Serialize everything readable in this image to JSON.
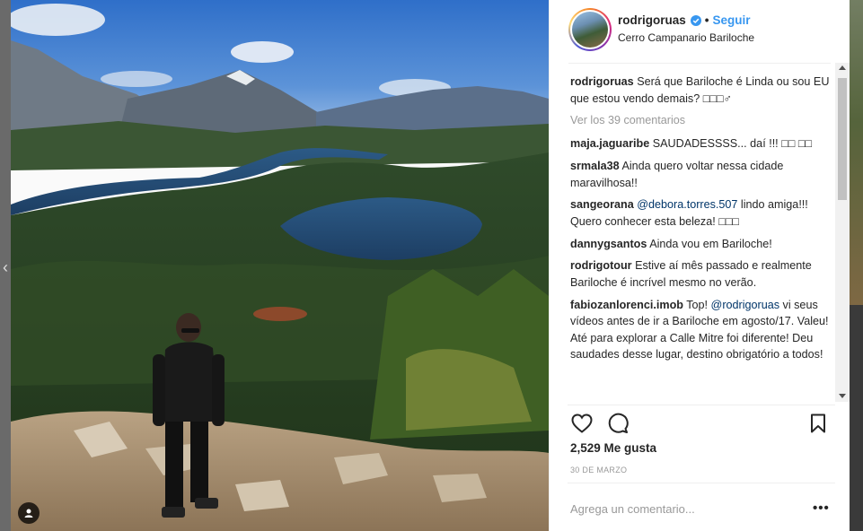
{
  "post": {
    "username": "rodrigoruas",
    "follow_label": "Seguir",
    "separator": "•",
    "location": "Cerro Campanario Bariloche",
    "caption": "Será que Bariloche é Linda ou sou EU que estou vendo demais? □□□♂",
    "view_comments": "Ver los 39 comentarios",
    "likes": "2,529 Me gusta",
    "date": "30 DE MARZO",
    "comment_placeholder": "Agrega un comentario...",
    "options_glyph": "•••"
  },
  "comments": [
    {
      "user": "maja.jaguaribe",
      "text": "SAUDADESSSS... daí !!! □□ □□"
    },
    {
      "user": "srmala38",
      "text": "Ainda quero voltar nessa cidade maravilhosa!!"
    },
    {
      "user": "sangeorana",
      "mention": "@debora.torres.507",
      "text": " lindo amiga!!! Quero conhecer esta beleza! □□□"
    },
    {
      "user": "dannygsantos",
      "text": "Ainda vou em Bariloche!"
    },
    {
      "user": "rodrigotour",
      "text": "Estive aí mês passado e realmente Bariloche é incrível mesmo no verão."
    },
    {
      "user": "fabiozanlorenci.imob",
      "text_before": "Top! ",
      "mention": "@rodrigoruas",
      "text": " vi seus vídeos antes de ir a Bariloche em agosto/17. Valeu! Até para explorar a Calle Mitre foi diferente! Deu saudades desse lugar, destino obrigatório a todos!"
    }
  ],
  "icons": {
    "verified": "verified-badge-icon",
    "like": "heart-icon",
    "comment": "comment-bubble-icon",
    "save": "bookmark-icon",
    "user_tag": "user-tag-icon",
    "prev": "chevron-left-icon"
  },
  "colors": {
    "link_blue": "#3897f0",
    "mention": "#003569",
    "muted": "#999999",
    "text": "#262626"
  }
}
